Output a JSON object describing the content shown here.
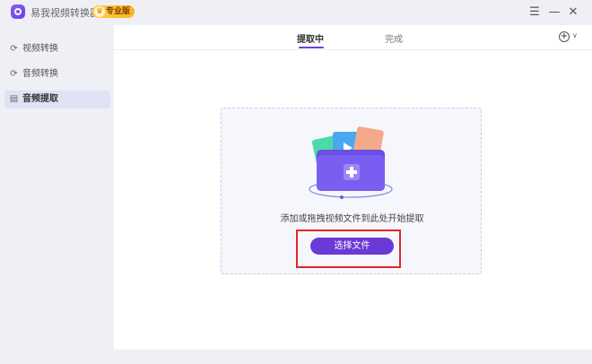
{
  "titlebar": {
    "app_title": "易我视频转换器",
    "badge": "专业版",
    "menu_icon": "menu-icon",
    "minimize_icon": "minimize-icon",
    "close_icon": "close-icon"
  },
  "sidebar": {
    "items": [
      {
        "label": "视频转换",
        "icon": "video-convert-icon",
        "active": false
      },
      {
        "label": "音频转换",
        "icon": "audio-convert-icon",
        "active": false
      },
      {
        "label": "音频提取",
        "icon": "audio-extract-icon",
        "active": true
      }
    ]
  },
  "tabs": [
    {
      "label": "提取中",
      "active": true
    },
    {
      "label": "完成",
      "active": false
    }
  ],
  "dropzone": {
    "hint": "添加或拖拽视频文件到此处开始提取",
    "button_label": "选择文件"
  },
  "colors": {
    "accent": "#6b39d8",
    "highlight": "#e0262a",
    "badge": "#ffbf2e"
  }
}
